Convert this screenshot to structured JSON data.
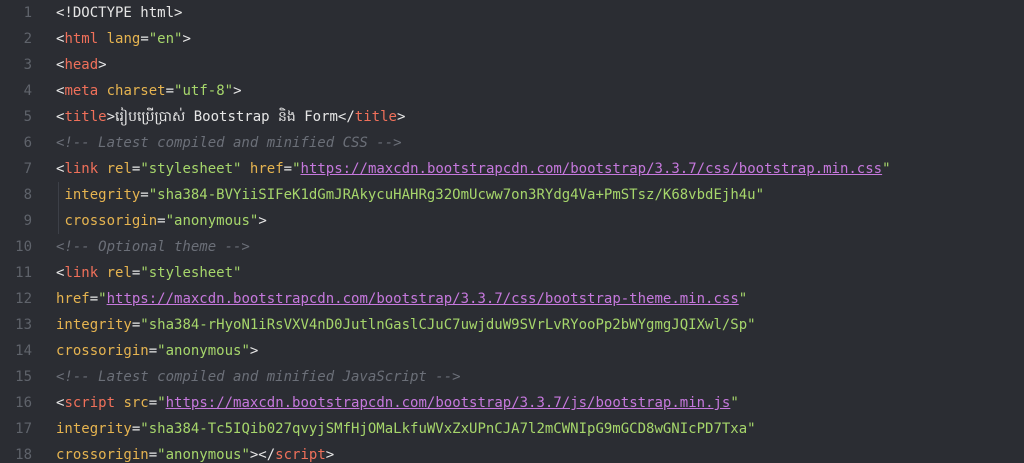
{
  "editor": {
    "lines": [
      {
        "num": "1",
        "segs": [
          {
            "t": "plain",
            "v": "<!DOCTYPE html>"
          }
        ]
      },
      {
        "num": "2",
        "segs": [
          {
            "t": "plain",
            "v": "<"
          },
          {
            "t": "tag",
            "v": "html"
          },
          {
            "t": "plain",
            "v": " "
          },
          {
            "t": "attr",
            "v": "lang"
          },
          {
            "t": "plain",
            "v": "="
          },
          {
            "t": "str",
            "v": "\"en\""
          },
          {
            "t": "plain",
            "v": ">"
          }
        ]
      },
      {
        "num": "3",
        "segs": [
          {
            "t": "plain",
            "v": "<"
          },
          {
            "t": "tag",
            "v": "head"
          },
          {
            "t": "plain",
            "v": ">"
          }
        ]
      },
      {
        "num": "4",
        "segs": [
          {
            "t": "plain",
            "v": "<"
          },
          {
            "t": "tag",
            "v": "meta"
          },
          {
            "t": "plain",
            "v": " "
          },
          {
            "t": "attr",
            "v": "charset"
          },
          {
            "t": "plain",
            "v": "="
          },
          {
            "t": "str",
            "v": "\"utf-8\""
          },
          {
            "t": "plain",
            "v": ">"
          }
        ]
      },
      {
        "num": "5",
        "segs": [
          {
            "t": "plain",
            "v": "<"
          },
          {
            "t": "tag",
            "v": "title"
          },
          {
            "t": "plain",
            "v": ">រៀបប្រើប្រាស់ Bootstrap និង Form</"
          },
          {
            "t": "tag",
            "v": "title"
          },
          {
            "t": "plain",
            "v": ">"
          }
        ]
      },
      {
        "num": "6",
        "segs": [
          {
            "t": "cmt",
            "v": "<!-- Latest compiled and minified CSS -->"
          }
        ]
      },
      {
        "num": "7",
        "segs": [
          {
            "t": "plain",
            "v": "<"
          },
          {
            "t": "tag",
            "v": "link"
          },
          {
            "t": "plain",
            "v": " "
          },
          {
            "t": "attr",
            "v": "rel"
          },
          {
            "t": "plain",
            "v": "="
          },
          {
            "t": "str",
            "v": "\"stylesheet\""
          },
          {
            "t": "plain",
            "v": " "
          },
          {
            "t": "attr",
            "v": "href"
          },
          {
            "t": "plain",
            "v": "="
          },
          {
            "t": "str",
            "v": "\""
          },
          {
            "t": "url",
            "v": "https://maxcdn.bootstrapcdn.com/bootstrap/3.3.7/css/bootstrap.min.css"
          },
          {
            "t": "str",
            "v": "\""
          }
        ]
      },
      {
        "num": "8",
        "segs": [
          {
            "t": "plain",
            "v": " "
          },
          {
            "t": "attr",
            "v": "integrity"
          },
          {
            "t": "plain",
            "v": "="
          },
          {
            "t": "str",
            "v": "\"sha384-BVYiiSIFeK1dGmJRAkycuHAHRg32OmUcww7on3RYdg4Va+PmSTsz/K68vbdEjh4u\""
          }
        ]
      },
      {
        "num": "9",
        "segs": [
          {
            "t": "plain",
            "v": " "
          },
          {
            "t": "attr",
            "v": "crossorigin"
          },
          {
            "t": "plain",
            "v": "="
          },
          {
            "t": "str",
            "v": "\"anonymous\""
          },
          {
            "t": "plain",
            "v": ">"
          }
        ]
      },
      {
        "num": "10",
        "segs": [
          {
            "t": "cmt",
            "v": "<!-- Optional theme -->"
          }
        ]
      },
      {
        "num": "11",
        "segs": [
          {
            "t": "plain",
            "v": "<"
          },
          {
            "t": "tag",
            "v": "link"
          },
          {
            "t": "plain",
            "v": " "
          },
          {
            "t": "attr",
            "v": "rel"
          },
          {
            "t": "plain",
            "v": "="
          },
          {
            "t": "str",
            "v": "\"stylesheet\""
          }
        ]
      },
      {
        "num": "12",
        "segs": [
          {
            "t": "attr",
            "v": "href"
          },
          {
            "t": "plain",
            "v": "="
          },
          {
            "t": "str",
            "v": "\""
          },
          {
            "t": "url",
            "v": "https://maxcdn.bootstrapcdn.com/bootstrap/3.3.7/css/bootstrap-theme.min.css"
          },
          {
            "t": "str",
            "v": "\""
          }
        ]
      },
      {
        "num": "13",
        "segs": [
          {
            "t": "attr",
            "v": "integrity"
          },
          {
            "t": "plain",
            "v": "="
          },
          {
            "t": "str",
            "v": "\"sha384-rHyoN1iRsVXV4nD0JutlnGaslCJuC7uwjduW9SVrLvRYooPp2bWYgmgJQIXwl/Sp\""
          }
        ]
      },
      {
        "num": "14",
        "segs": [
          {
            "t": "attr",
            "v": "crossorigin"
          },
          {
            "t": "plain",
            "v": "="
          },
          {
            "t": "str",
            "v": "\"anonymous\""
          },
          {
            "t": "plain",
            "v": ">"
          }
        ]
      },
      {
        "num": "15",
        "segs": [
          {
            "t": "cmt",
            "v": "<!-- Latest compiled and minified JavaScript -->"
          }
        ]
      },
      {
        "num": "16",
        "segs": [
          {
            "t": "plain",
            "v": "<"
          },
          {
            "t": "tag",
            "v": "script"
          },
          {
            "t": "plain",
            "v": " "
          },
          {
            "t": "attr",
            "v": "src"
          },
          {
            "t": "plain",
            "v": "="
          },
          {
            "t": "str",
            "v": "\""
          },
          {
            "t": "url",
            "v": "https://maxcdn.bootstrapcdn.com/bootstrap/3.3.7/js/bootstrap.min.js"
          },
          {
            "t": "str",
            "v": "\""
          }
        ]
      },
      {
        "num": "17",
        "segs": [
          {
            "t": "attr",
            "v": "integrity"
          },
          {
            "t": "plain",
            "v": "="
          },
          {
            "t": "str",
            "v": "\"sha384-Tc5IQib027qvyjSMfHjOMaLkfuWVxZxUPnCJA7l2mCWNIpG9mGCD8wGNIcPD7Txa\""
          }
        ]
      },
      {
        "num": "18",
        "segs": [
          {
            "t": "attr",
            "v": "crossorigin"
          },
          {
            "t": "plain",
            "v": "="
          },
          {
            "t": "str",
            "v": "\"anonymous\""
          },
          {
            "t": "plain",
            "v": "></"
          },
          {
            "t": "tag",
            "v": "script"
          },
          {
            "t": "plain",
            "v": ">"
          }
        ]
      }
    ]
  },
  "colors": {
    "background": "#2b2d33",
    "line_number": "#5f636b",
    "tag": "#f0705a",
    "attribute": "#e6b450",
    "string": "#a6d66b",
    "url": "#c678dd",
    "comment": "#6b6f78",
    "text": "#e6e6e6"
  }
}
